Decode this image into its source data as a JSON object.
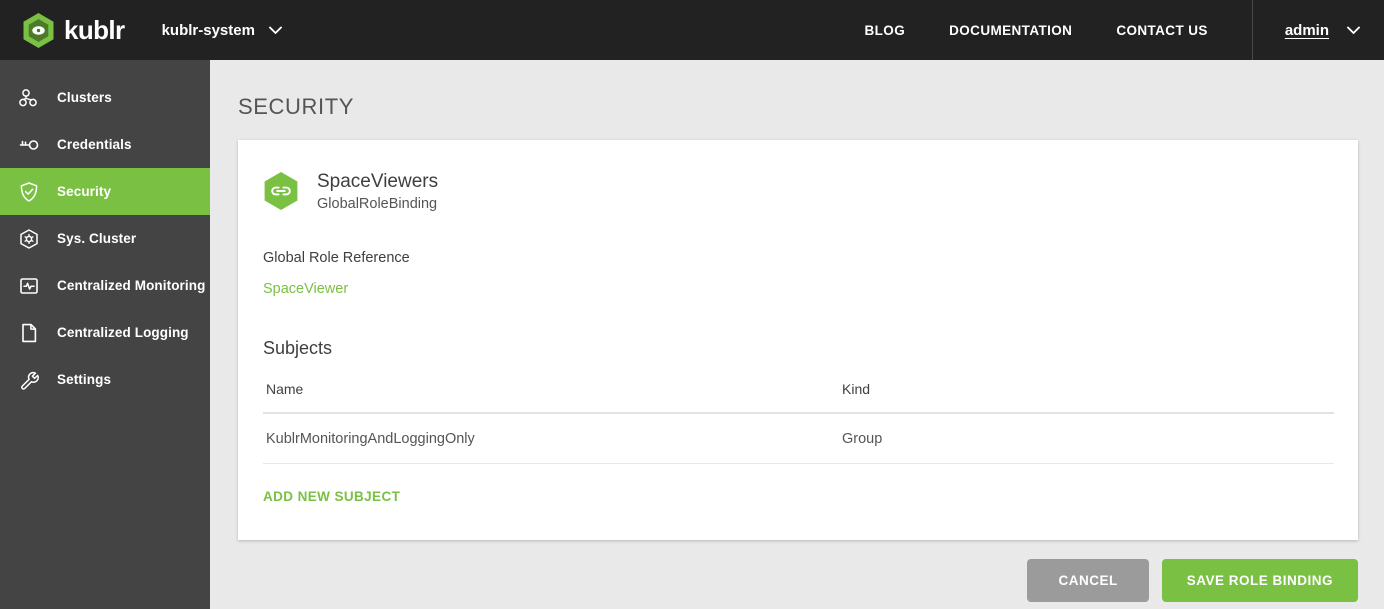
{
  "header": {
    "brand_name": "kublr",
    "brand_logo_icon": "kublr-hexagon-logo",
    "space_selector": {
      "value": "kublr-system",
      "chevron_icon": "chevron-down-icon"
    },
    "nav_links": [
      {
        "label": "BLOG",
        "name": "blog"
      },
      {
        "label": "DOCUMENTATION",
        "name": "documentation"
      },
      {
        "label": "CONTACT US",
        "name": "contact-us"
      }
    ],
    "user": {
      "name": "admin",
      "chevron_icon": "chevron-down-icon"
    }
  },
  "sidebar": {
    "items": [
      {
        "label": "Clusters",
        "icon": "clusters-icon",
        "active": false
      },
      {
        "label": "Credentials",
        "icon": "key-icon",
        "active": false
      },
      {
        "label": "Security",
        "icon": "shield-check-icon",
        "active": true
      },
      {
        "label": "Sys. Cluster",
        "icon": "hexagon-gear-icon",
        "active": false
      },
      {
        "label": "Centralized Monitoring",
        "icon": "monitor-pulse-icon",
        "active": false
      },
      {
        "label": "Centralized Logging",
        "icon": "document-icon",
        "active": false
      },
      {
        "label": "Settings",
        "icon": "wrench-icon",
        "active": false
      }
    ]
  },
  "main": {
    "page_title": "SECURITY",
    "card": {
      "icon": "link-hexagon-icon",
      "title": "SpaceViewers",
      "subtitle": "GlobalRoleBinding",
      "role_reference_label": "Global Role Reference",
      "role_reference_value": "SpaceViewer",
      "subjects_heading": "Subjects",
      "table": {
        "columns": [
          "Name",
          "Kind"
        ],
        "rows": [
          {
            "name": "KublrMonitoringAndLoggingOnly",
            "kind": "Group"
          }
        ]
      },
      "add_subject_label": "ADD NEW SUBJECT"
    },
    "actions": {
      "cancel_label": "CANCEL",
      "save_label": "SAVE ROLE BINDING"
    }
  },
  "colors": {
    "accent_green": "#7ac143",
    "header_dark": "#222222",
    "sidebar_dark": "#444444",
    "page_bg": "#e9e9e9",
    "cancel_gray": "#9b9b9b"
  }
}
